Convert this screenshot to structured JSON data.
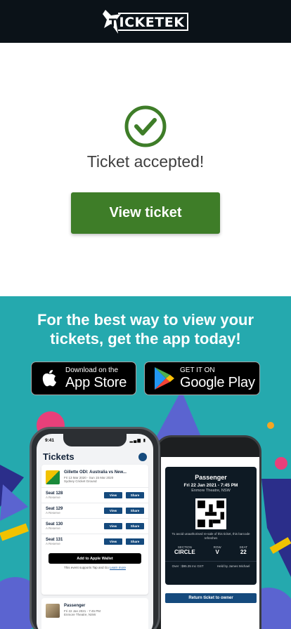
{
  "header": {
    "logo_text": "TICKETEK"
  },
  "accepted": {
    "title": "Ticket accepted!",
    "button_label": "View ticket"
  },
  "promo": {
    "title": "For the best way to view your tickets, get the app today!",
    "app_store": {
      "small": "Download on the",
      "big": "App Store"
    },
    "google_play": {
      "small": "GET IT ON",
      "big": "Google Play"
    }
  },
  "phone_front": {
    "time": "9:41",
    "title": "Tickets",
    "event": {
      "name": "Gillette ODI: Australia vs New...",
      "date": "Fri 13 Mar 2020 - Sun 15 Mar 2020",
      "venue": "Sydney Cricket Ground"
    },
    "seats": [
      {
        "name": "Seat 128",
        "type": "A Reserve"
      },
      {
        "name": "Seat 129",
        "type": "A Reserve"
      },
      {
        "name": "Seat 130",
        "type": "A Reserve"
      },
      {
        "name": "Seat 131",
        "type": "A Reserve"
      }
    ],
    "view_label": "View",
    "share_label": "Share",
    "wallet_label": "Add to Apple Wallet",
    "wallet_note": "This event supports Tap and Go",
    "learn_more": "Learn more",
    "event2": {
      "name": "Passenger",
      "date": "Fri 22 Jan 2021 - 7:45 PM",
      "venue": "Enmore Theatre, NSW"
    }
  },
  "phone_back": {
    "name": "Passenger",
    "date": "Fri 22 Jan 2021 - 7:45 PM",
    "venue": "Enmore Theatre, NSW",
    "note": "To avoid unauthorised re-sale of this ticket, this barcode refreshes",
    "section_label": "SECTION",
    "section": "CIRCLE",
    "row_label": "ROW",
    "row": "V",
    "seat_label": "SEAT",
    "seat": "22",
    "price": "Over : $95.35 Inc GST",
    "holder": "Held by James Michael",
    "return_label": "Return ticket to owner"
  },
  "colors": {
    "header": "#0b1218",
    "accent_green": "#3e7d28",
    "promo_bg": "#25a9ae",
    "ticket_blue": "#154a7d"
  }
}
